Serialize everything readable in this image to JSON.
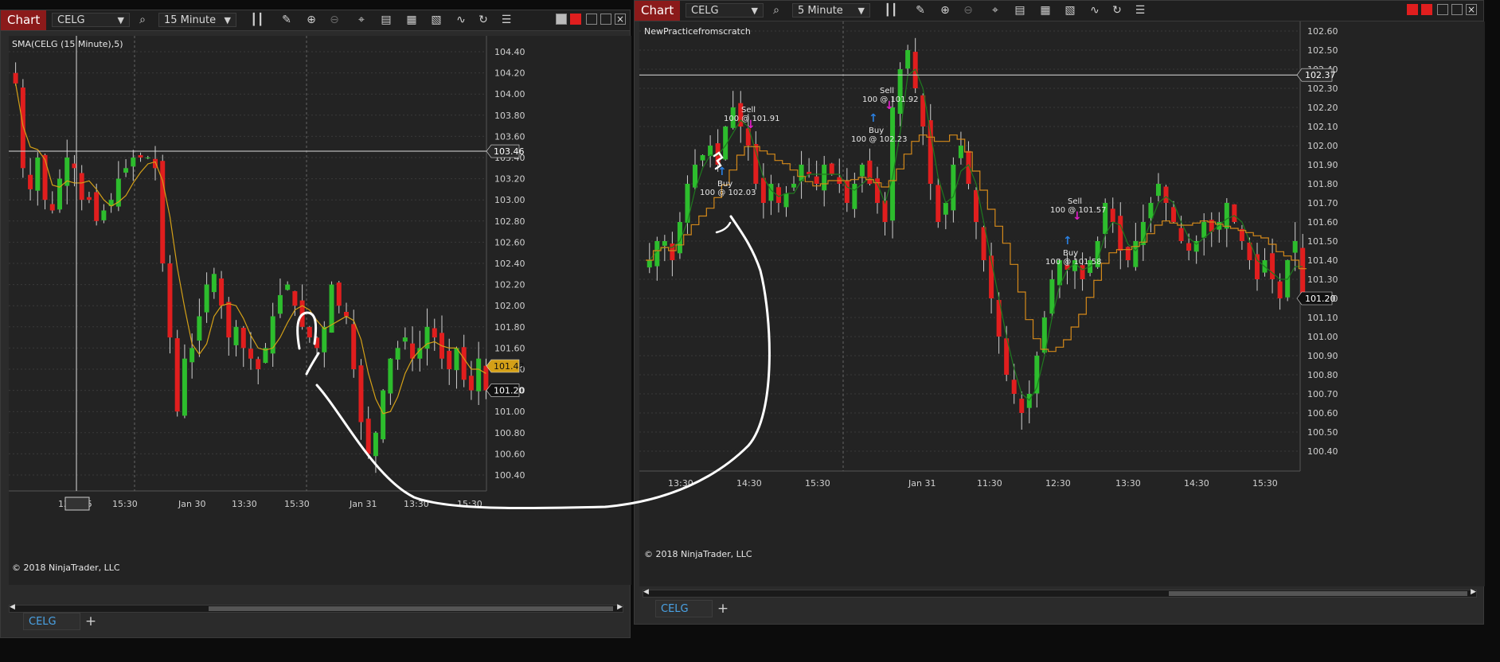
{
  "left": {
    "title": "Chart",
    "symbol": "CELG",
    "interval": "15 Minute",
    "indicator_label": "SMA(CELG (15 Minute),5)",
    "copyright": "© 2018 NinjaTrader, LLC",
    "price_axis": [
      "104.40",
      "104.20",
      "104.00",
      "103.80",
      "103.60",
      "103.40",
      "103.20",
      "103.00",
      "102.80",
      "102.60",
      "102.40",
      "102.20",
      "102.00",
      "101.80",
      "101.60",
      "101.40",
      "101.20",
      "101.00",
      "100.80",
      "100.60",
      "100.40"
    ],
    "price_tags": {
      "crosshair": "103.46",
      "sma": "101.43",
      "last": "101.20"
    },
    "time_axis": [
      "13:45",
      "15:30",
      "Jan 30",
      "13:30",
      "15:30",
      "Jan 31",
      "13:30",
      "15:30"
    ],
    "time_axis_partial": "13",
    "tab": "CELG",
    "colors": {
      "up": "#2dbd2d",
      "down": "#e01e1e",
      "sma": "#d4a017",
      "sma_tag": "#d4a017"
    }
  },
  "right": {
    "title": "Chart",
    "symbol": "CELG",
    "interval": "5 Minute",
    "strategy_label": "NewPracticefromscratch",
    "copyright": "© 2018 NinjaTrader, LLC",
    "price_axis": [
      "102.60",
      "102.50",
      "102.40",
      "102.30",
      "102.20",
      "102.10",
      "102.00",
      "101.90",
      "101.80",
      "101.70",
      "101.60",
      "101.50",
      "101.40",
      "101.30",
      "101.20",
      "101.10",
      "101.00",
      "100.90",
      "100.80",
      "100.70",
      "100.60",
      "100.50",
      "100.40"
    ],
    "price_tags": {
      "crosshair": "102.37",
      "last": "101.20"
    },
    "time_axis": [
      "13:30",
      "14:30",
      "15:30",
      "Jan 31",
      "11:30",
      "12:30",
      "13:30",
      "14:30",
      "15:30"
    ],
    "tab": "CELG",
    "executions": [
      {
        "side": "Sell",
        "text": "100 @ 101.91"
      },
      {
        "side": "Buy",
        "text": "100 @ 102.03"
      },
      {
        "side": "Sell",
        "text": "100 @ 101.92"
      },
      {
        "side": "Buy",
        "text": "100 @ 102.23"
      },
      {
        "side": "Sell",
        "text": "100 @ 101.57"
      },
      {
        "side": "Buy",
        "text": "100 @ 101.58"
      }
    ],
    "colors": {
      "up": "#2dbd2d",
      "down": "#e01e1e",
      "stop": "#d4891a",
      "fast": "#1f7a1f",
      "buy_arrow": "#2a7fe0",
      "sell_arrow": "#e01ec8"
    }
  }
}
